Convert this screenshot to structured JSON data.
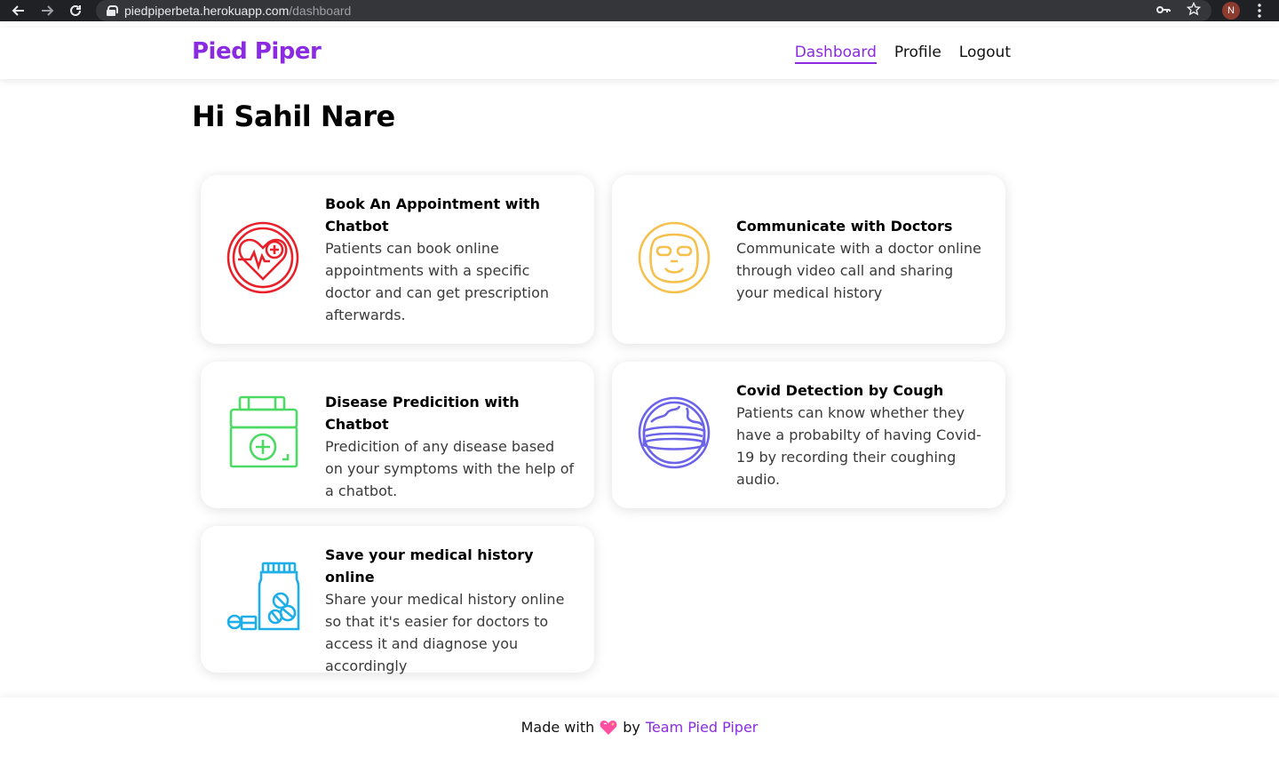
{
  "browser": {
    "url_host": "piedpiperbeta.herokuapp.com",
    "url_path": "/dashboard",
    "avatar_letter": "N",
    "icons": [
      "back-arrow-icon",
      "forward-arrow-icon",
      "reload-icon",
      "lock-icon",
      "key-icon",
      "star-icon",
      "more-vert-icon"
    ]
  },
  "header": {
    "brand": "Pied Piper",
    "nav": [
      {
        "label": "Dashboard",
        "active": true
      },
      {
        "label": "Profile",
        "active": false
      },
      {
        "label": "Logout",
        "active": false
      }
    ]
  },
  "greeting": "Hi Sahil Nare",
  "cards": [
    {
      "title": "Book An Appointment with Chatbot",
      "description": "Patients can book online appointments with a specific doctor and can get prescription afterwards.",
      "icon": "heart-medical-icon",
      "icon_color": "#e8202a"
    },
    {
      "title": "Communicate with Doctors",
      "description": "Communicate with a doctor online through video call and sharing your medical history",
      "icon": "face-mask-icon",
      "icon_color": "#f5c04c"
    },
    {
      "title": "Disease Predicition with Chatbot",
      "description": "Predicition of any disease based on your symptoms with the help of a chatbot.",
      "icon": "first-aid-kit-icon",
      "icon_color": "#4cd964"
    },
    {
      "title": "Covid Detection by Cough",
      "description": "Patients can know whether they have a probabilty of having Covid-19 by recording their coughing audio.",
      "icon": "globe-mask-icon",
      "icon_color": "#6b63e8"
    },
    {
      "title": "Save your medical history online",
      "description": "Share your medical history online so that it's easier for doctors to access it and diagnose you accordingly",
      "icon": "medicine-bottle-icon",
      "icon_color": "#1eaee8"
    }
  ],
  "footer": {
    "made_with": "Made with",
    "by": "by",
    "team": "Team Pied Piper",
    "heart_color": "#ff4fa3"
  }
}
